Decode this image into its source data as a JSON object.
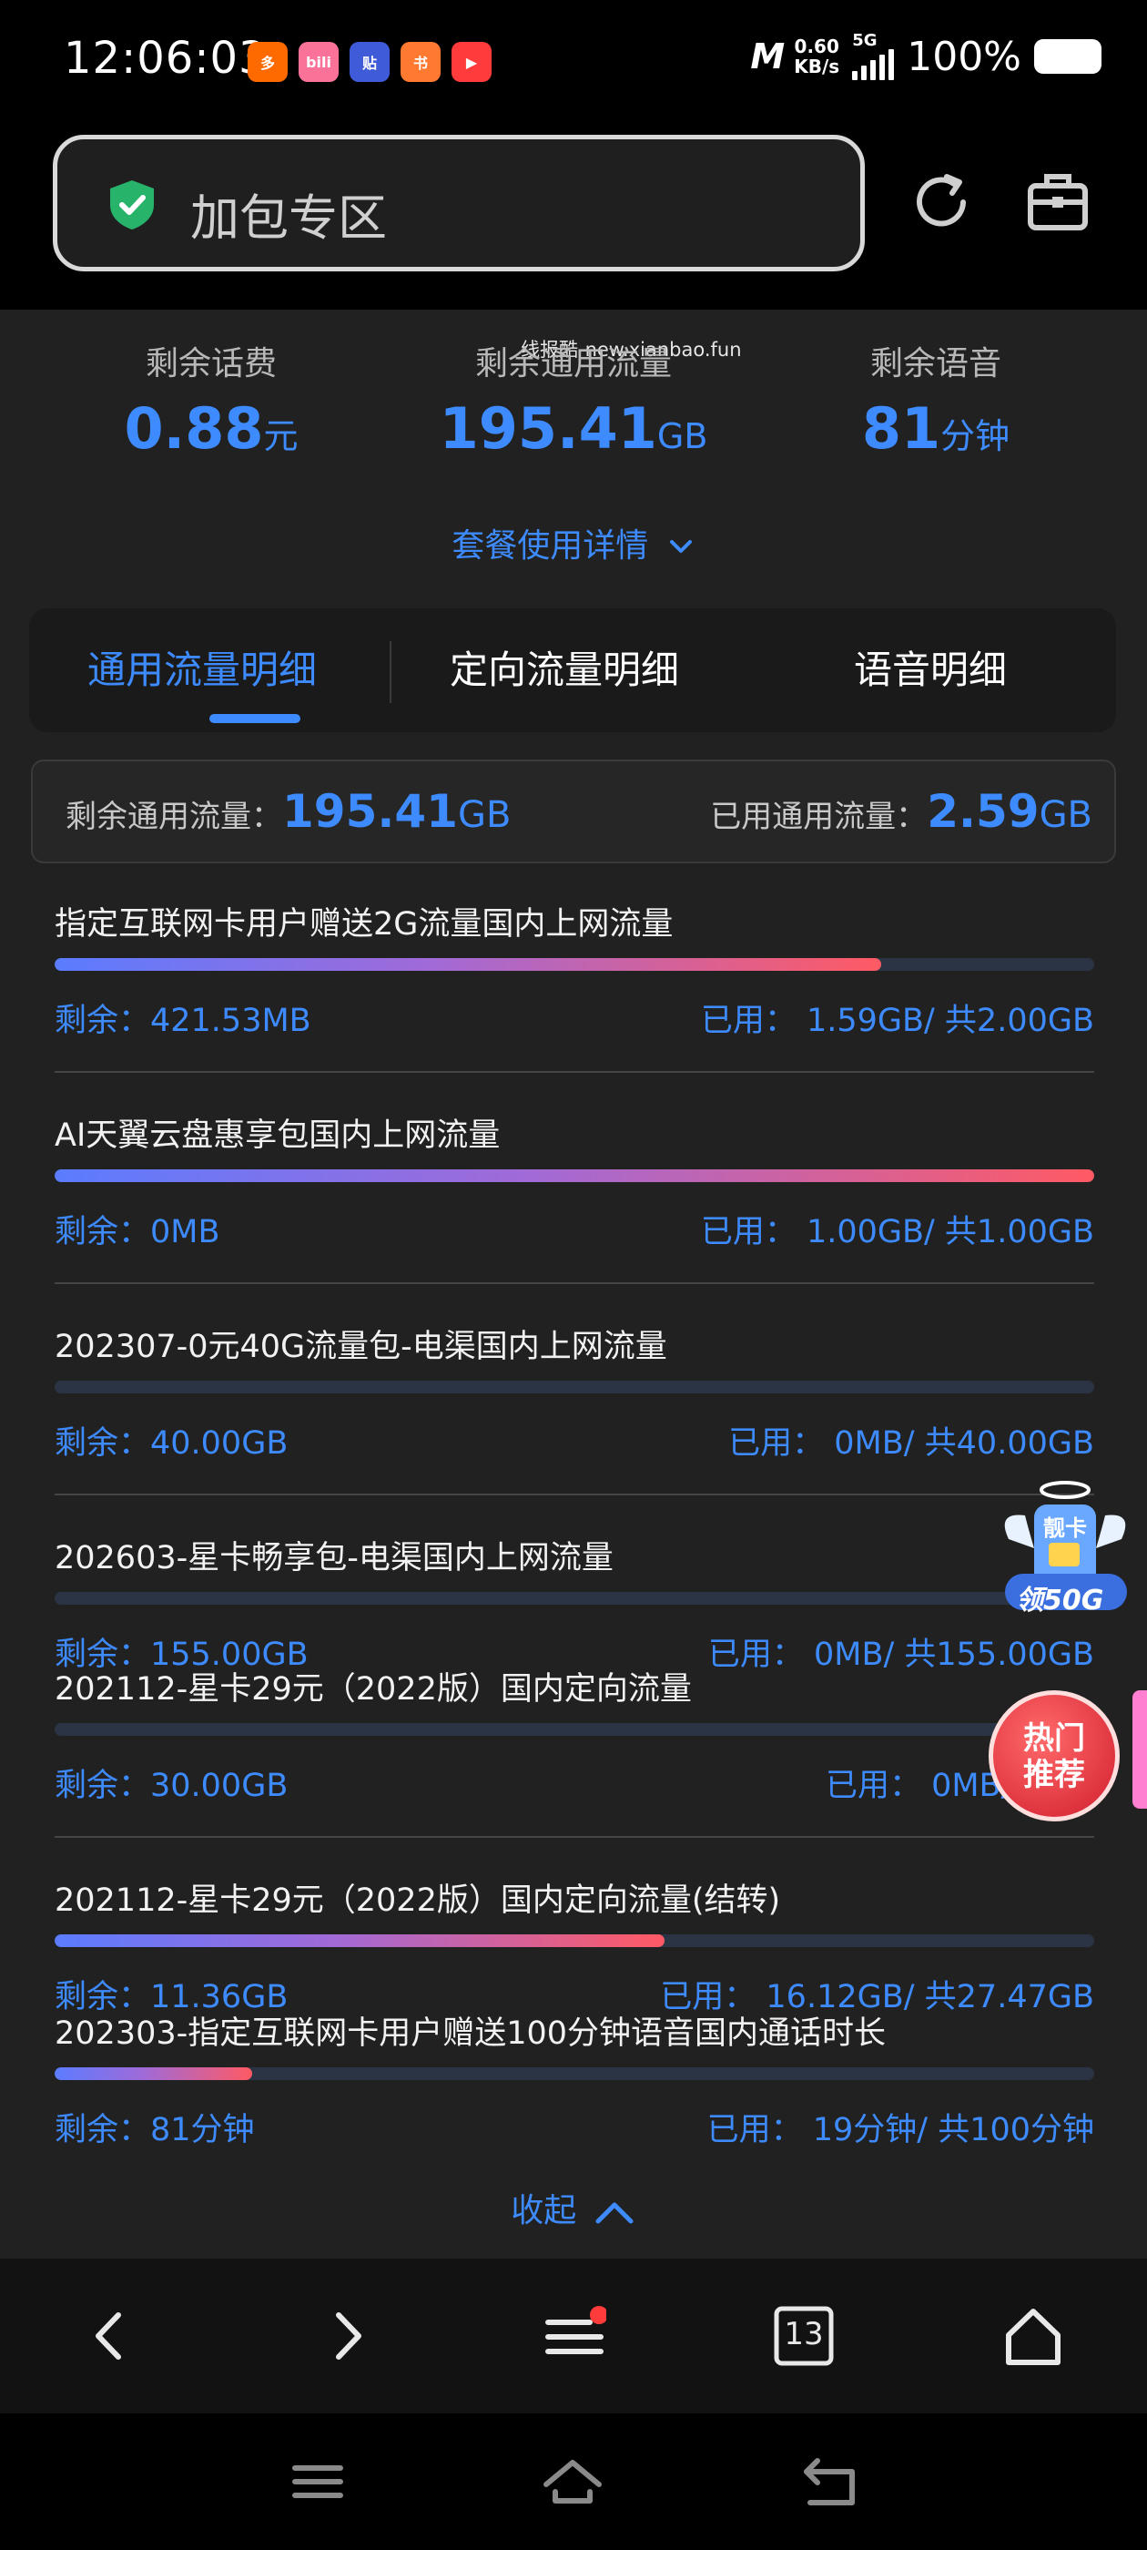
{
  "status_bar": {
    "time": "12:06:03",
    "app_icons": [
      {
        "name": "app-icon-1",
        "label": "多",
        "color": "#ff6a00"
      },
      {
        "name": "app-icon-2",
        "label": "bili",
        "color": "#fb7299"
      },
      {
        "name": "app-icon-3",
        "label": "贴",
        "color": "#3f5bd8"
      },
      {
        "name": "app-icon-4",
        "label": "书",
        "color": "#ff7a30"
      },
      {
        "name": "app-icon-5",
        "label": "▶",
        "color": "#ff3b3b"
      }
    ],
    "net_speed_value": "0.60",
    "net_speed_unit": "KB/s",
    "network_type": "5G",
    "battery_text": "100%"
  },
  "header": {
    "search_text": "加包专区"
  },
  "stats": [
    {
      "label": "剩余话费",
      "value": "0.88",
      "unit": "元"
    },
    {
      "label": "剩余通用流量",
      "value": "195.41",
      "unit": "GB"
    },
    {
      "label": "剩余语音",
      "value": "81",
      "unit": "分钟"
    }
  ],
  "watermark": "线报酷-new.xianbao.fun",
  "details_link": "套餐使用详情",
  "tabs": [
    {
      "label": "通用流量明细",
      "active": true
    },
    {
      "label": "定向流量明细",
      "active": false
    },
    {
      "label": "语音明细",
      "active": false
    }
  ],
  "summary": {
    "remaining_label": "剩余通用流量：",
    "remaining_value": "195.41",
    "remaining_unit": "GB",
    "used_label": "已用通用流量：",
    "used_value": "2.59",
    "used_unit": "GB"
  },
  "items": [
    {
      "title": "指定互联网卡用户赠送2G流量国内上网流量",
      "remaining": "剩余：421.53MB",
      "used": "已用： 1.59GB/ 共2.00GB",
      "progress": 0.795,
      "separator": true
    },
    {
      "title": "AI天翼云盘惠享包国内上网流量",
      "remaining": "剩余：0MB",
      "used": "已用： 1.00GB/ 共1.00GB",
      "progress": 1.0,
      "separator": true
    },
    {
      "title": "202307-0元40G流量包-电渠国内上网流量",
      "remaining": "剩余：40.00GB",
      "used": "已用： 0MB/ 共40.00GB",
      "progress": 0.0,
      "separator": true
    },
    {
      "title": "202603-星卡畅享包-电渠国内上网流量",
      "remaining": "剩余：155.00GB",
      "used": "已用： 0MB/ 共155.00GB",
      "progress": 0.0,
      "separator": false
    },
    {
      "title": "202112-星卡29元（2022版）国内定向流量",
      "remaining": "剩余：30.00GB",
      "used": "已用： 0MB/ 共30",
      "progress": 0.0,
      "separator": true
    },
    {
      "title": "202112-星卡29元（2022版）国内定向流量(结转)",
      "remaining": "剩余：11.36GB",
      "used": "已用： 16.12GB/ 共27.47GB",
      "progress": 0.587,
      "separator": false
    },
    {
      "title": "202303-指定互联网卡用户赠送100分钟语音国内通话时长",
      "remaining": "剩余：81分钟",
      "used": "已用： 19分钟/ 共100分钟",
      "progress": 0.19,
      "separator": false
    }
  ],
  "collapse_label": "收起",
  "floating": {
    "card_label": "领50G",
    "card_top": "靓卡",
    "hot_label_1": "热门",
    "hot_label_2": "推荐"
  },
  "browser_nav": {
    "tab_count": "13"
  },
  "colors": {
    "accent": "#3d8bff",
    "panel": "#212121",
    "progress_start": "#5b7cff",
    "progress_end": "#ff5a64"
  }
}
